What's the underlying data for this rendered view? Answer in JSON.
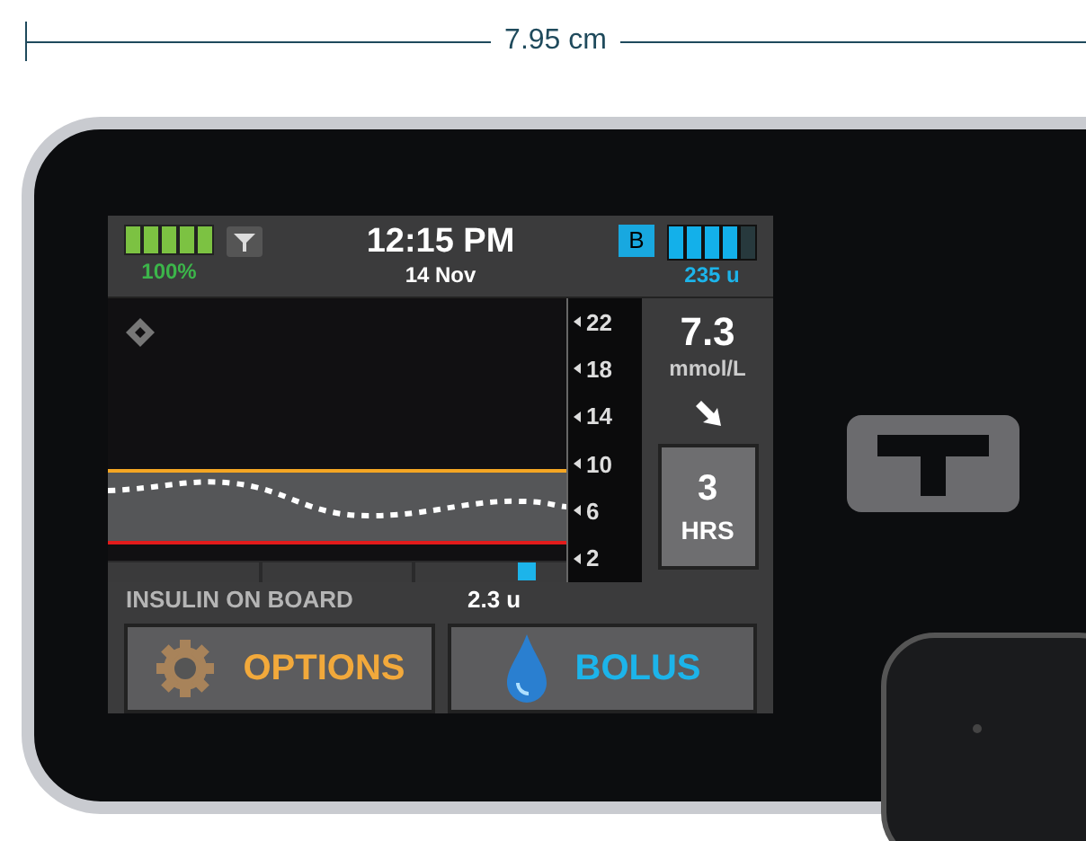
{
  "dimension": {
    "label": "7.95 cm"
  },
  "status_bar": {
    "battery": {
      "level": 1.0,
      "label": "100%"
    },
    "time": "12:15 PM",
    "date": "14 Nov",
    "badge": "B",
    "insulin": {
      "level": 0.8,
      "label": "235 u"
    }
  },
  "graph": {
    "y_labels": [
      "22",
      "18",
      "14",
      "10",
      "6",
      "2"
    ]
  },
  "reading": {
    "value": "7.3",
    "unit": "mmol/L"
  },
  "range_button": {
    "value": "3",
    "unit": "HRS"
  },
  "insulin_on_board": {
    "label": "INSULIN ON BOARD",
    "value": "2.3 u"
  },
  "buttons": [
    {
      "kind": "options",
      "label": "OPTIONS"
    },
    {
      "kind": "bolus",
      "label": "BOLUS"
    }
  ]
}
